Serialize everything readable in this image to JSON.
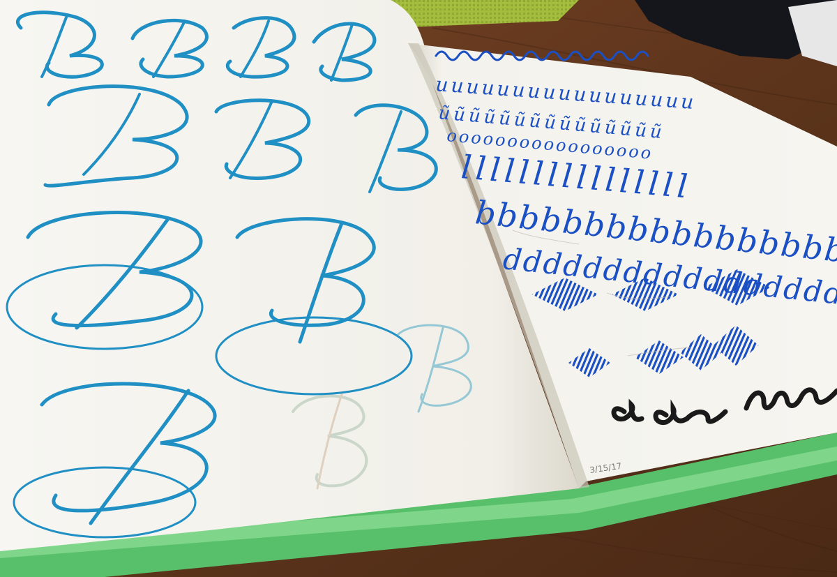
{
  "scene": {
    "colors": {
      "table": "#6b3d20",
      "table_dark": "#3e2212",
      "table_light": "#8a5533",
      "placemat": "#9fb83a",
      "page": "#f4f3ee",
      "page_shadow": "#d9d6cc",
      "cover": "#5cc25f",
      "teal_ink": "#1f8fc4",
      "royal_ink": "#1b4fc4",
      "black_ink": "#1a1a1a",
      "pencil": "#b9b6ad"
    },
    "left_page_letter": "B",
    "date_note": "3/15/17",
    "practice_rows": [
      "uuuuuuuuuuuuuuuuu",
      "ũũũũũũũũũũũũũũũ",
      "ooooooooooooooooo",
      "llllllllllllllll",
      "bbbbbbbbbbbbbbbbb",
      "ddddddddddddddddd"
    ],
    "bottom_word": "a a ∿∿∿"
  }
}
